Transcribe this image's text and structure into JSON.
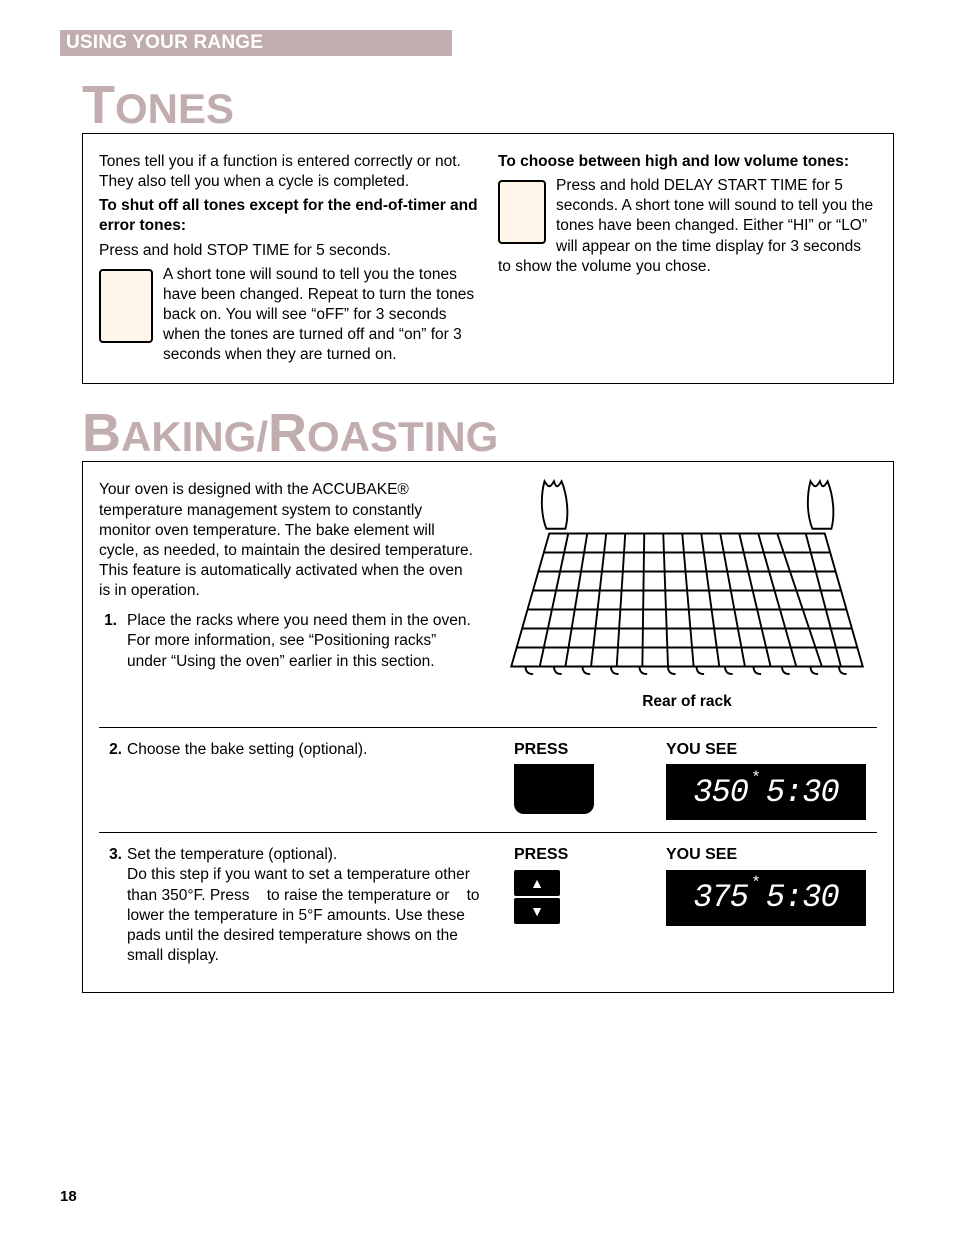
{
  "header": {
    "title": "USING YOUR RANGE"
  },
  "tones": {
    "heading_big": "T",
    "heading_rest": "ONES",
    "intro": "Tones tell you if a function is entered correctly or not. They also tell you when a cycle is completed.",
    "shutoff_heading": "To shut off all tones except for the end-of-timer and error tones:",
    "shutoff_action": "Press and hold STOP TIME for 5 seconds.",
    "shutoff_body": "A short tone will sound to tell you the tones have been changed. Repeat to turn the tones back on. You will see “oFF” for 3 seconds when the tones are turned off and “on” for 3 seconds when they are turned on.",
    "volume_heading": "To choose between high and low volume tones:",
    "volume_body": "Press and hold DELAY START TIME for 5 seconds. A short tone will sound to tell you the tones have been changed. Either “HI” or “LO” will appear on the time display for 3 seconds to show the volume you chose."
  },
  "baking": {
    "heading_big1": "B",
    "heading_mid": "AKING",
    "heading_slash": "/",
    "heading_big2": "R",
    "heading_rest": "OASTING",
    "intro": "Your oven is designed with the ACCUBAKE® temperature management system to constantly monitor oven temperature. The bake element will cycle, as needed, to maintain the desired temperature. This feature is automatically activated when the oven is in operation.",
    "rack_caption": "Rear of rack",
    "step1_num": "1.",
    "step1_title": "Place the racks where you need them in the oven.",
    "step1_body": "For more information, see “Positioning racks” under “Using the oven” earlier in this section.",
    "step2_num": "2.",
    "step2_title": "Choose the bake setting (optional).",
    "step3_num": "3.",
    "step3_title": "Set the temperature (optional).",
    "step3_body": "Do this step if you want to set a temperature other than 350°F. Press    to raise the temperature or    to lower the temperature in 5°F amounts. Use these pads until the desired temperature shows on the small display.",
    "press_label": "PRESS",
    "yousee_label": "YOU SEE",
    "display2_temp": "350",
    "display2_time": "5:30",
    "display3_temp": "375",
    "display3_time": "5:30"
  },
  "page_number": "18"
}
